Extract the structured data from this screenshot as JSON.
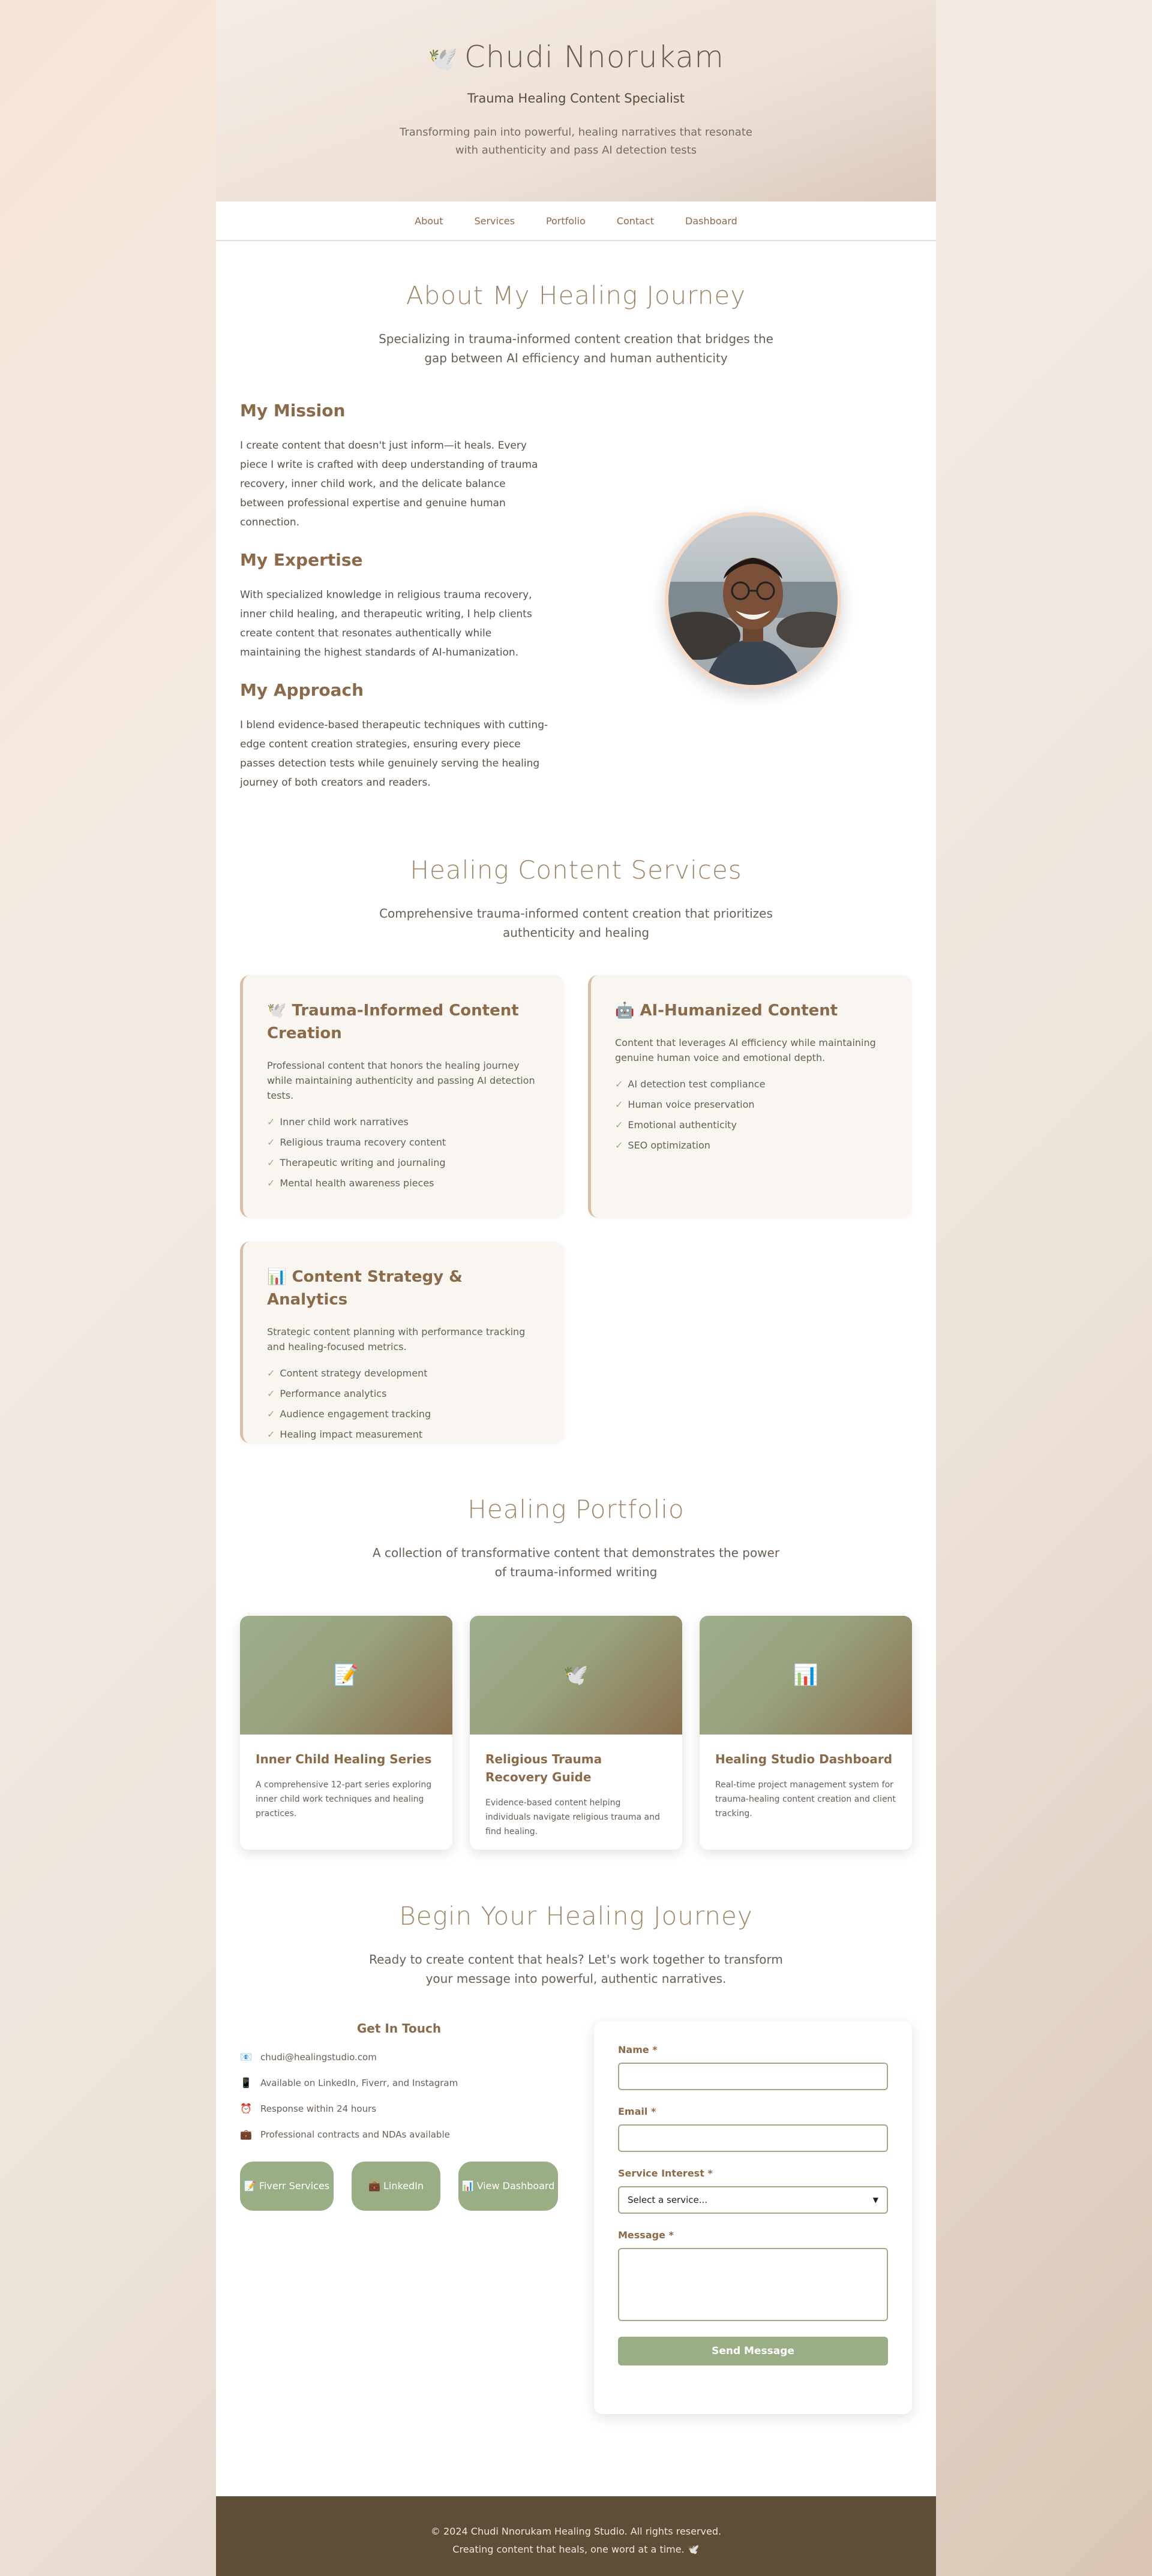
{
  "header": {
    "title": "Chudi Nnorukam",
    "title_icon": "🕊️",
    "subtitle": "Trauma Healing Content Specialist",
    "tagline": "Transforming pain into powerful, healing narratives that resonate with authenticity and pass AI detection tests"
  },
  "nav": [
    "About",
    "Services",
    "Portfolio",
    "Contact",
    "Dashboard"
  ],
  "about": {
    "title": "About My Healing Journey",
    "lead": "Specializing in trauma-informed content creation that bridges the gap between AI efficiency and human authenticity",
    "blocks": [
      {
        "heading": "My Mission",
        "text": "I create content that doesn't just inform—it heals. Every piece I write is crafted with deep understanding of trauma recovery, inner child work, and the delicate balance between professional expertise and genuine human connection."
      },
      {
        "heading": "My Expertise",
        "text": "With specialized knowledge in religious trauma recovery, inner child healing, and therapeutic writing, I help clients create content that resonates authentically while maintaining the highest standards of AI-humanization."
      },
      {
        "heading": "My Approach",
        "text": "I blend evidence-based therapeutic techniques with cutting-edge content creation strategies, ensuring every piece passes detection tests while genuinely serving the healing journey of both creators and readers."
      }
    ]
  },
  "services": {
    "title": "Healing Content Services",
    "lead": "Comprehensive trauma-informed content creation that prioritizes authenticity and healing",
    "cards": [
      {
        "icon": "🕊️",
        "title": "Trauma-Informed Content Creation",
        "desc": "Professional content that honors the healing journey while maintaining authenticity and passing AI detection tests.",
        "items": [
          "Inner child work narratives",
          "Religious trauma recovery content",
          "Therapeutic writing and journaling",
          "Mental health awareness pieces"
        ]
      },
      {
        "icon": "🤖",
        "title": "AI-Humanized Content",
        "desc": "Content that leverages AI efficiency while maintaining genuine human voice and emotional depth.",
        "items": [
          "AI detection test compliance",
          "Human voice preservation",
          "Emotional authenticity",
          "SEO optimization"
        ]
      },
      {
        "icon": "📊",
        "title": "Content Strategy & Analytics",
        "desc": "Strategic content planning with performance tracking and healing-focused metrics.",
        "items": [
          "Content strategy development",
          "Performance analytics",
          "Audience engagement tracking",
          "Healing impact measurement"
        ]
      }
    ],
    "check": "✓"
  },
  "portfolio": {
    "title": "Healing Portfolio",
    "lead": "A collection of transformative content that demonstrates the power of trauma-informed writing",
    "items": [
      {
        "icon": "📝",
        "title": "Inner Child Healing Series",
        "desc": "A comprehensive 12-part series exploring inner child work techniques and healing practices."
      },
      {
        "icon": "🕊️",
        "title": "Religious Trauma Recovery Guide",
        "desc": "Evidence-based content helping individuals navigate religious trauma and find healing."
      },
      {
        "icon": "📊",
        "title": "Healing Studio Dashboard",
        "desc": "Real-time project management system for trauma-healing content creation and client tracking."
      }
    ]
  },
  "contact": {
    "title": "Begin Your Healing Journey",
    "lead": "Ready to create content that heals? Let's work together to transform your message into powerful, authentic narratives.",
    "get_in_touch": "Get In Touch",
    "info": [
      {
        "icon": "📧",
        "text": "chudi@healingstudio.com"
      },
      {
        "icon": "📱",
        "text": "Available on LinkedIn, Fiverr, and Instagram"
      },
      {
        "icon": "⏰",
        "text": "Response within 24 hours"
      },
      {
        "icon": "💼",
        "text": "Professional contracts and NDAs available"
      }
    ],
    "buttons": [
      {
        "icon": "📝",
        "label": "Fiverr Services"
      },
      {
        "icon": "💼",
        "label": "LinkedIn"
      },
      {
        "icon": "📊",
        "label": "View Dashboard"
      }
    ],
    "form": {
      "name_label": "Name *",
      "email_label": "Email *",
      "service_label": "Service Interest *",
      "service_selected": "Select a service...",
      "message_label": "Message *",
      "submit": "Send Message"
    }
  },
  "footer": {
    "line1": "© 2024 Chudi Nnorukam Healing Studio. All rights reserved.",
    "line2": "Creating content that heals, one word at a time. 🕊️"
  }
}
